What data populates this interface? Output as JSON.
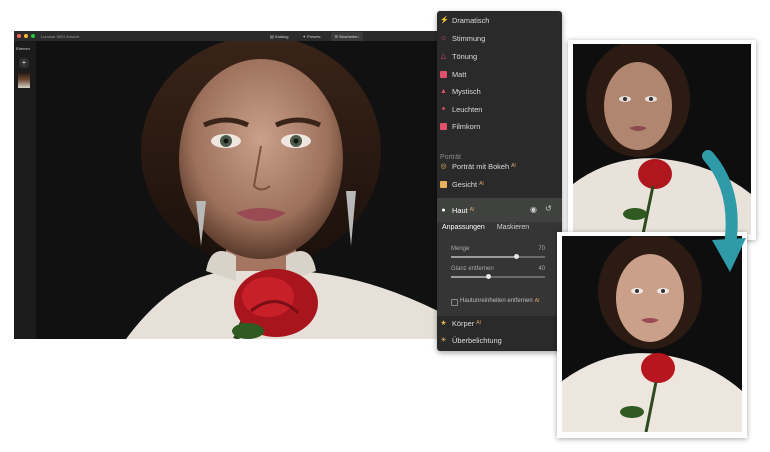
{
  "app": {
    "title": "Luminar NEO Ansicht",
    "toolbar": [
      {
        "label": "Katalog",
        "icon": "folder-icon",
        "active": false
      },
      {
        "label": "Presets",
        "icon": "sparkle-icon",
        "active": false
      },
      {
        "label": "Bearbeiten",
        "icon": "sliders-icon",
        "active": true
      }
    ],
    "sidebar": {
      "label": "Ebenen",
      "add": "+"
    }
  },
  "panel": {
    "tools": [
      {
        "label": "Dramatisch",
        "icon": "lightning-icon",
        "color": "#e0516b"
      },
      {
        "label": "Stimmung",
        "icon": "mood-icon",
        "color": "#e0516b"
      },
      {
        "label": "Tönung",
        "icon": "toning-icon",
        "color": "#e0516b"
      },
      {
        "label": "Matt",
        "icon": "matte-icon",
        "color": "#e0516b"
      },
      {
        "label": "Mystisch",
        "icon": "mystic-icon",
        "color": "#e0516b"
      },
      {
        "label": "Leuchten",
        "icon": "glow-icon",
        "color": "#e0516b"
      },
      {
        "label": "Filmkorn",
        "icon": "film-grain-icon",
        "color": "#e0516b"
      }
    ],
    "section_portrait": "Porträt",
    "portrait_tools": [
      {
        "label": "Porträt mit Bokeh",
        "icon": "bokeh-icon",
        "badge": "AI"
      },
      {
        "label": "Gesicht",
        "icon": "face-icon",
        "badge": "AI"
      }
    ],
    "haut": {
      "label": "Haut",
      "badge": "AI",
      "tabs": [
        "Anpassungen",
        "Maskieren"
      ],
      "sliders": [
        {
          "label": "Menge",
          "value": "70",
          "level": 0.7
        },
        {
          "label": "Glanz entfernen",
          "value": "40",
          "level": 0.4
        }
      ],
      "checkbox": {
        "label": "Hautunreinheiten entfernen",
        "badge": "AI",
        "checked": false
      }
    },
    "bottom_tools": [
      {
        "label": "Körper",
        "icon": "body-icon",
        "badge": "AI"
      },
      {
        "label": "Überbelichtung",
        "icon": "overexposure-icon",
        "badge": ""
      }
    ]
  },
  "colors": {
    "accent": "#e0516b",
    "ai_badge": "#e0a86a",
    "arrow": "#2f9aa8"
  }
}
